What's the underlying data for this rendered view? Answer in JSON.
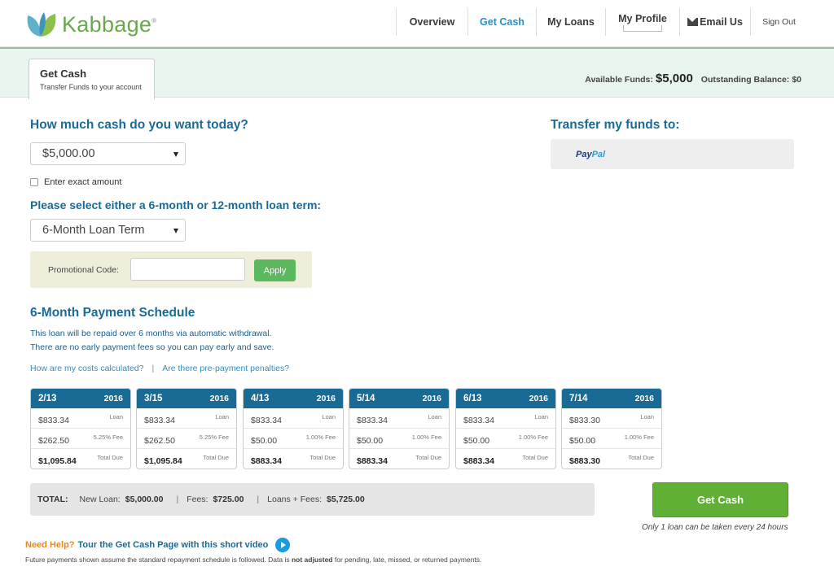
{
  "brand": {
    "name": "Kabbage",
    "trademark": "®"
  },
  "nav": {
    "overview": "Overview",
    "get_cash": "Get Cash",
    "my_loans": "My Loans",
    "my_profile": "My Profile",
    "email_us": "Email Us",
    "sign_out": "Sign Out"
  },
  "tab": {
    "title": "Get Cash",
    "subtitle": "Transfer Funds to your account"
  },
  "funds": {
    "available_label": "Available Funds:",
    "available_value": "$5,000",
    "outstanding_label": "Outstanding Balance:",
    "outstanding_value": "$0"
  },
  "amount": {
    "heading": "How much cash do you want today?",
    "selected": "$5,000.00",
    "exact_label": "Enter exact amount"
  },
  "term": {
    "heading": "Please select either a 6-month or 12-month loan term:",
    "selected": "6-Month Loan Term"
  },
  "promo": {
    "label": "Promotional Code:",
    "value": "",
    "apply": "Apply"
  },
  "schedule": {
    "heading": "6-Month Payment Schedule",
    "line1": "This loan will be repaid over 6 months via automatic withdrawal.",
    "line2": "There are no early payment fees so you can pay early and save.",
    "link1": "How are my costs calculated?",
    "link2": "Are there pre-payment penalties?",
    "sep": "|",
    "payments": [
      {
        "date": "2/13",
        "year": "2016",
        "loan": "$833.34",
        "loan_label": "Loan",
        "fee": "$262.50",
        "fee_label": "5.25% Fee",
        "total": "$1,095.84",
        "total_label": "Total Due"
      },
      {
        "date": "3/15",
        "year": "2016",
        "loan": "$833.34",
        "loan_label": "Loan",
        "fee": "$262.50",
        "fee_label": "5.25% Fee",
        "total": "$1,095.84",
        "total_label": "Total Due"
      },
      {
        "date": "4/13",
        "year": "2016",
        "loan": "$833.34",
        "loan_label": "Loan",
        "fee": "$50.00",
        "fee_label": "1.00% Fee",
        "total": "$883.34",
        "total_label": "Total Due"
      },
      {
        "date": "5/14",
        "year": "2016",
        "loan": "$833.34",
        "loan_label": "Loan",
        "fee": "$50.00",
        "fee_label": "1.00% Fee",
        "total": "$883.34",
        "total_label": "Total Due"
      },
      {
        "date": "6/13",
        "year": "2016",
        "loan": "$833.34",
        "loan_label": "Loan",
        "fee": "$50.00",
        "fee_label": "1.00% Fee",
        "total": "$883.34",
        "total_label": "Total Due"
      },
      {
        "date": "7/14",
        "year": "2016",
        "loan": "$833.30",
        "loan_label": "Loan",
        "fee": "$50.00",
        "fee_label": "1.00% Fee",
        "total": "$883.30",
        "total_label": "Total Due"
      }
    ]
  },
  "totals": {
    "label": "TOTAL:",
    "new_loan_label": "New Loan:",
    "new_loan_value": "$5,000.00",
    "fees_label": "Fees:",
    "fees_value": "$725.00",
    "sum_label": "Loans + Fees:",
    "sum_value": "$5,725.00",
    "pipe": "|"
  },
  "cta": {
    "button": "Get Cash",
    "note": "Only 1 loan can be taken every 24 hours"
  },
  "help": {
    "need": "Need Help?",
    "tour": "Tour the Get Cash Page with this short video",
    "footnote_pre": "Future payments shown assume the standard repayment schedule is followed. Data is",
    "footnote_bold": "not adjusted",
    "footnote_post": "for pending, late, missed, or returned payments."
  },
  "transfer": {
    "heading": "Transfer my funds to:",
    "paypal_a": "Pay",
    "paypal_b": "Pal"
  },
  "colors": {
    "brand_green": "#6aa84f",
    "heading_blue": "#1a6a96",
    "link_blue": "#2a8fc9",
    "button_green": "#5fb034",
    "help_orange": "#e8871e"
  }
}
